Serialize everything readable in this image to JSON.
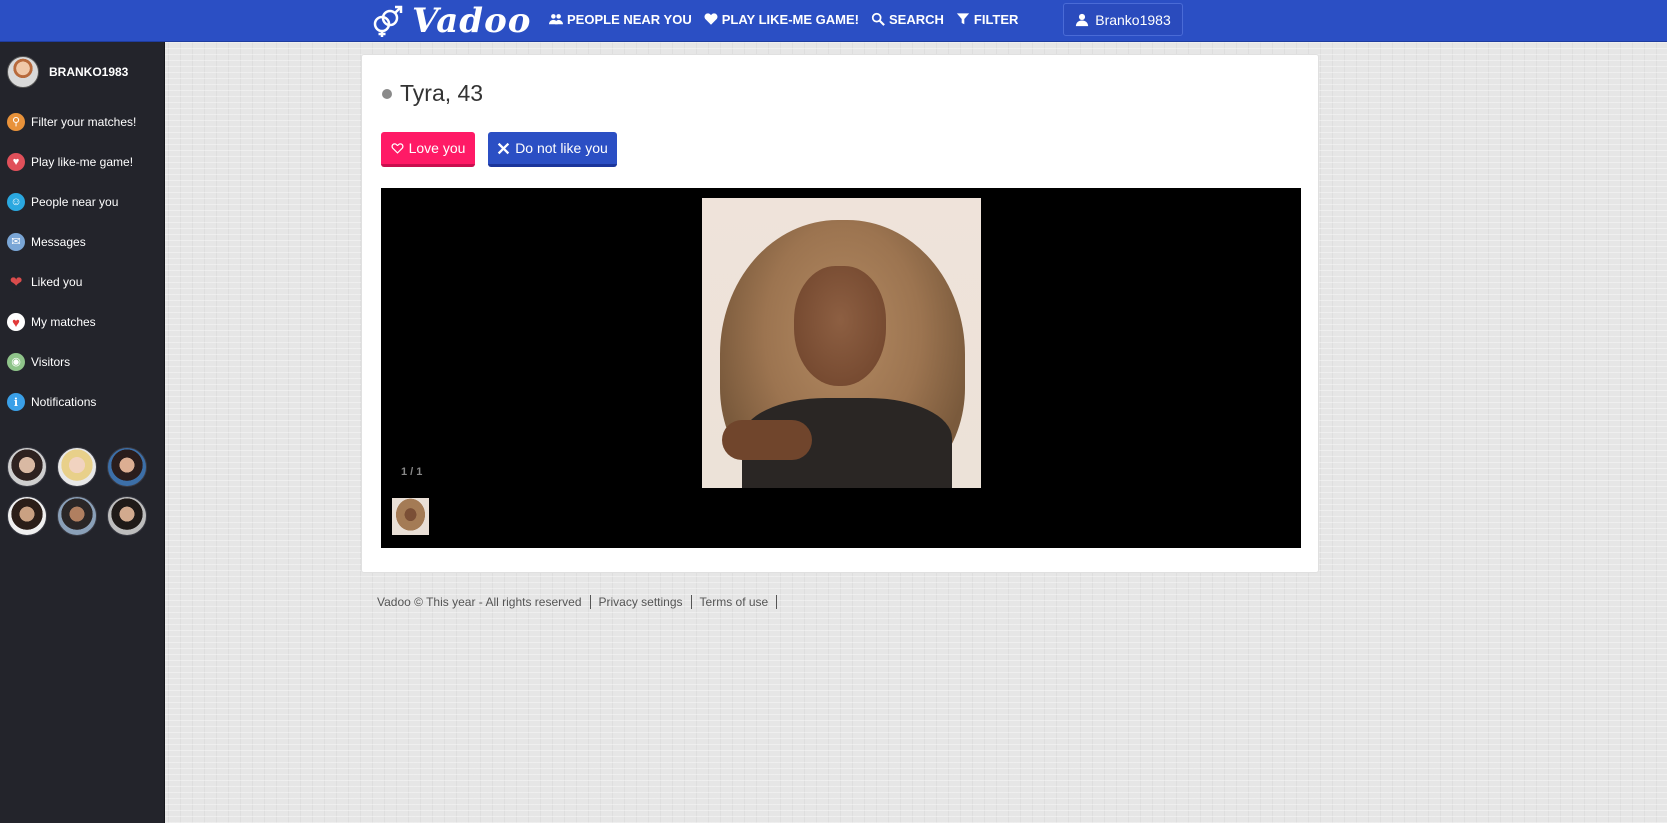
{
  "brand": {
    "name": "Vadoo"
  },
  "nav": {
    "items": [
      {
        "label": "PEOPLE NEAR YOU",
        "icon": "users-icon"
      },
      {
        "label": "PLAY LIKE-ME GAME!",
        "icon": "heart-icon"
      },
      {
        "label": "SEARCH",
        "icon": "search-icon"
      },
      {
        "label": "FILTER",
        "icon": "filter-icon"
      }
    ],
    "user_button": "Branko1983"
  },
  "sidebar": {
    "username": "BRANKO1983",
    "items": [
      {
        "label": "Filter your matches!",
        "icon": "magnifier-icon",
        "color": "#e8923a"
      },
      {
        "label": "Play like-me game!",
        "icon": "heart-icon",
        "color": "#e0505a"
      },
      {
        "label": "People near you",
        "icon": "person-icon",
        "color": "#2aa8e0"
      },
      {
        "label": "Messages",
        "icon": "envelope-icon",
        "color": "#7aa6d6"
      },
      {
        "label": "Liked you",
        "icon": "hand-heart-icon",
        "color": "#d94c4c"
      },
      {
        "label": "My matches",
        "icon": "heart-icon",
        "color": "#e23a3a"
      },
      {
        "label": "Visitors",
        "icon": "eye-icon",
        "color": "#8fc48a"
      },
      {
        "label": "Notifications",
        "icon": "info-icon",
        "color": "#3aa0e8"
      }
    ]
  },
  "profile": {
    "name_age": "Tyra, 43",
    "love_label": "Love you",
    "dislike_label": "Do not like you",
    "photo_counter": "1 / 1"
  },
  "footer": {
    "copyright": "Vadoo © This year - All rights reserved",
    "privacy": "Privacy settings",
    "terms": "Terms of use"
  },
  "colors": {
    "topbar": "#2b4fc4",
    "sidebar": "#23242b",
    "love_button": "#ff1a66",
    "dislike_button": "#2b4fc4"
  }
}
